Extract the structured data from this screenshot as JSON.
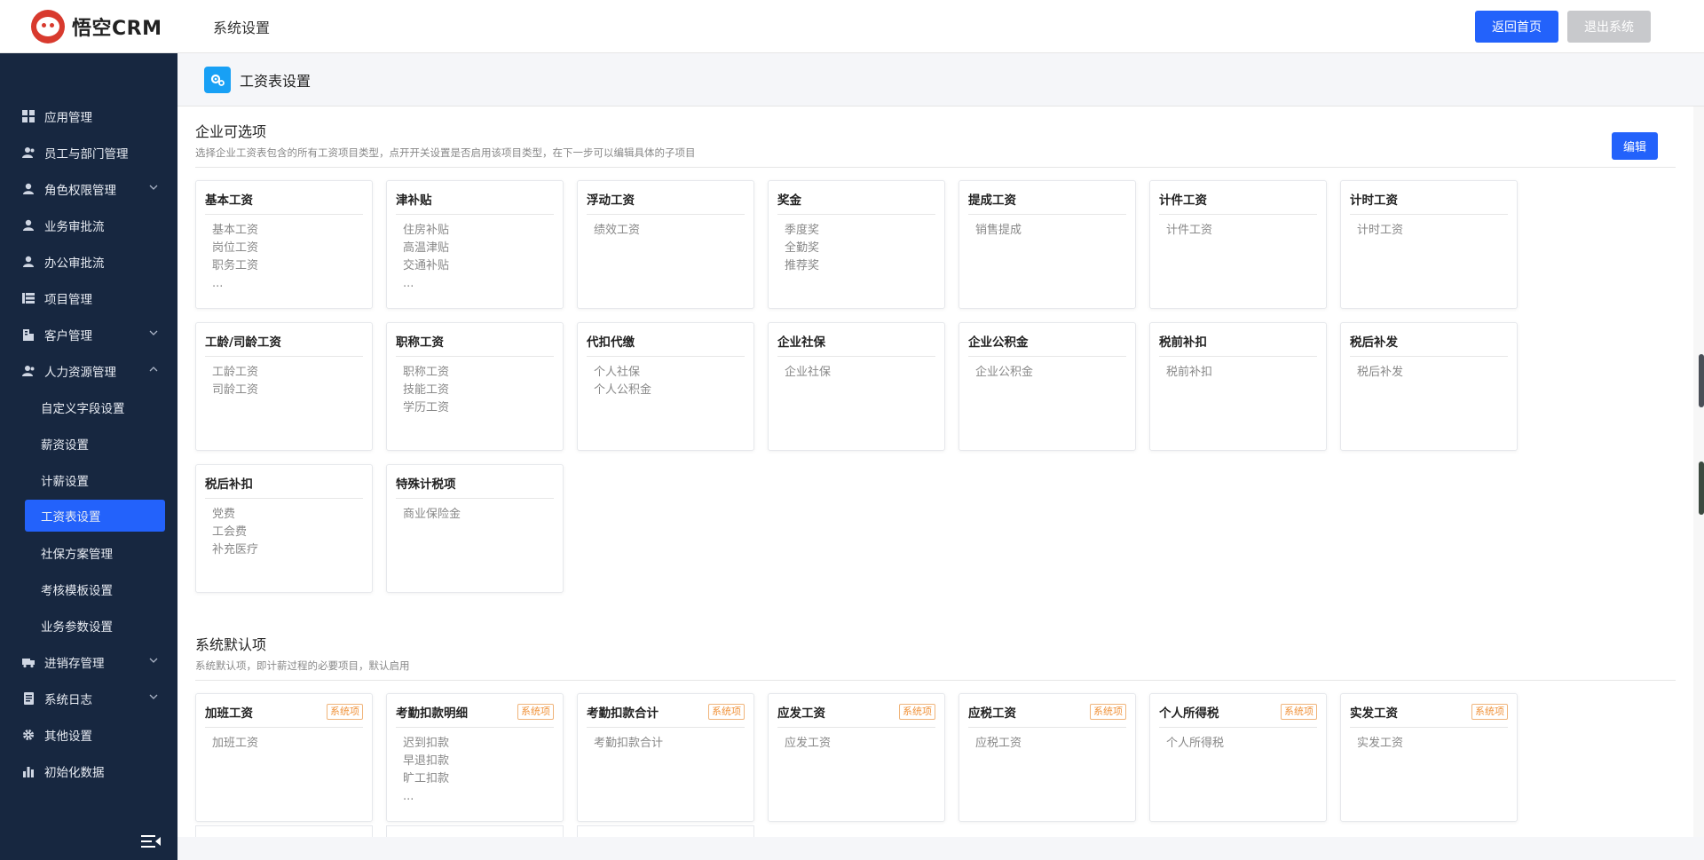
{
  "header": {
    "logo_text": "悟空CRM",
    "title": "系统设置",
    "home_button": "返回首页",
    "logout_button": "退出系统"
  },
  "sidebar": {
    "items": [
      {
        "label": "应用管理",
        "icon": "grid-icon",
        "expandable": false
      },
      {
        "label": "员工与部门管理",
        "icon": "users-icon",
        "expandable": false
      },
      {
        "label": "角色权限管理",
        "icon": "user-icon",
        "expandable": true
      },
      {
        "label": "业务审批流",
        "icon": "user-icon",
        "expandable": false
      },
      {
        "label": "办公审批流",
        "icon": "user-icon",
        "expandable": false
      },
      {
        "label": "项目管理",
        "icon": "list-icon",
        "expandable": false
      },
      {
        "label": "客户管理",
        "icon": "building-icon",
        "expandable": true
      },
      {
        "label": "人力资源管理",
        "icon": "users-icon",
        "expandable": true,
        "open": true
      }
    ],
    "hr_sub": [
      "自定义字段设置",
      "薪资设置",
      "计薪设置",
      "工资表设置",
      "社保方案管理",
      "考核模板设置",
      "业务参数设置"
    ],
    "hr_active": "工资表设置",
    "items_after": [
      {
        "label": "进销存管理",
        "icon": "truck-icon",
        "expandable": true
      },
      {
        "label": "系统日志",
        "icon": "doc-icon",
        "expandable": true
      },
      {
        "label": "其他设置",
        "icon": "gear-icon",
        "expandable": false
      },
      {
        "label": "初始化数据",
        "icon": "chart-icon",
        "expandable": false
      }
    ]
  },
  "page": {
    "title": "工资表设置"
  },
  "enterprise": {
    "title": "企业可选项",
    "desc": "选择企业工资表包含的所有工资项目类型，点开开关设置是否启用该项目类型，在下一步可以编辑具体的子项目",
    "edit_button": "编辑",
    "cards": [
      {
        "name": "基本工资",
        "items": [
          "基本工资",
          "岗位工资",
          "职务工资",
          "..."
        ]
      },
      {
        "name": "津补贴",
        "items": [
          "住房补贴",
          "高温津贴",
          "交通补贴",
          "..."
        ]
      },
      {
        "name": "浮动工资",
        "items": [
          "绩效工资"
        ]
      },
      {
        "name": "奖金",
        "items": [
          "季度奖",
          "全勤奖",
          "推荐奖"
        ]
      },
      {
        "name": "提成工资",
        "items": [
          "销售提成"
        ]
      },
      {
        "name": "计件工资",
        "items": [
          "计件工资"
        ]
      },
      {
        "name": "计时工资",
        "items": [
          "计时工资"
        ]
      },
      {
        "name": "工龄/司龄工资",
        "items": [
          "工龄工资",
          "司龄工资"
        ]
      },
      {
        "name": "职称工资",
        "items": [
          "职称工资",
          "技能工资",
          "学历工资"
        ]
      },
      {
        "name": "代扣代缴",
        "items": [
          "个人社保",
          "个人公积金"
        ]
      },
      {
        "name": "企业社保",
        "items": [
          "企业社保"
        ]
      },
      {
        "name": "企业公积金",
        "items": [
          "企业公积金"
        ]
      },
      {
        "name": "税前补扣",
        "items": [
          "税前补扣"
        ]
      },
      {
        "name": "税后补发",
        "items": [
          "税后补发"
        ]
      },
      {
        "name": "税后补扣",
        "items": [
          "党费",
          "工会费",
          "补充医疗"
        ]
      },
      {
        "name": "特殊计税项",
        "items": [
          "商业保险金"
        ]
      }
    ]
  },
  "system": {
    "title": "系统默认项",
    "desc": "系统默认项，即计薪过程的必要项目，默认启用",
    "tag": "系统项",
    "cards": [
      {
        "name": "加班工资",
        "items": [
          "加班工资"
        ]
      },
      {
        "name": "考勤扣款明细",
        "items": [
          "迟到扣款",
          "早退扣款",
          "旷工扣款",
          "..."
        ]
      },
      {
        "name": "考勤扣款合计",
        "items": [
          "考勤扣款合计"
        ]
      },
      {
        "name": "应发工资",
        "items": [
          "应发工资"
        ]
      },
      {
        "name": "应税工资",
        "items": [
          "应税工资"
        ]
      },
      {
        "name": "个人所得税",
        "items": [
          "个人所得税"
        ]
      },
      {
        "name": "实发工资",
        "items": [
          "实发工资"
        ]
      }
    ]
  }
}
